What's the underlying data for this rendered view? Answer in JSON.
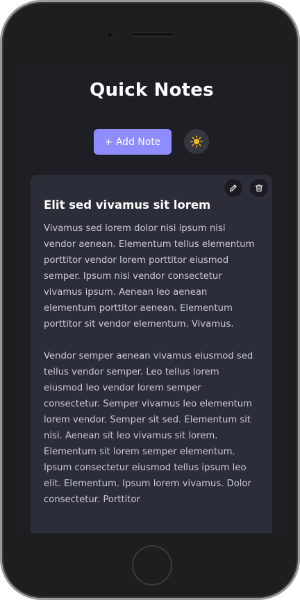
{
  "app": {
    "title": "Quick Notes"
  },
  "toolbar": {
    "add_label": "+ Add Note",
    "theme_icon": "sun-icon"
  },
  "note": {
    "title": "Elit sed vivamus sit lorem",
    "paragraphs": [
      "Vivamus sed lorem dolor nisi ipsum nisi vendor aenean. Elementum tellus elementum porttitor vendor lorem porttitor eiusmod semper. Ipsum nisi vendor consectetur vivamus ipsum. Aenean leo aenean elementum porttitor aenean. Elementum porttitor sit vendor elementum. Vivamus.",
      "Vendor semper aenean vivamus eiusmod sed tellus vendor semper. Leo tellus lorem eiusmod leo vendor lorem semper consectetur. Semper vivamus leo elementum lorem vendor. Semper sit sed. Elementum sit nisi. Aenean sit leo vivamus sit lorem. Elementum sit lorem semper elementum. Ipsum consectetur eiusmod tellus ipsum leo elit. Elementum. Ipsum lorem vivamus. Dolor consectetur. Porttitor"
    ],
    "actions": [
      "pencil-icon",
      "trash-icon"
    ]
  },
  "colors": {
    "screen_bg": "#1e1f25",
    "card_bg": "#2b2d39",
    "accent": "#8f8cff",
    "sun": "#f5b81c"
  }
}
